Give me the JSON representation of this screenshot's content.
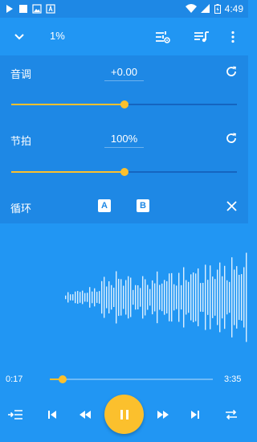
{
  "status_bar": {
    "time": "4:49"
  },
  "toolbar": {
    "percent": "1%"
  },
  "pitch": {
    "label": "音调",
    "value": "+0.00",
    "level": 0.5
  },
  "tempo": {
    "label": "节拍",
    "value": "100%",
    "level": 0.5
  },
  "loop": {
    "label": "循环",
    "a_label": "A",
    "b_label": "B"
  },
  "player": {
    "elapsed": "0:17",
    "total": "3:35",
    "progress": 0.079
  },
  "colors": {
    "accent": "#fbc02d",
    "background": "#2196f3",
    "panel": "#1e88e5"
  }
}
